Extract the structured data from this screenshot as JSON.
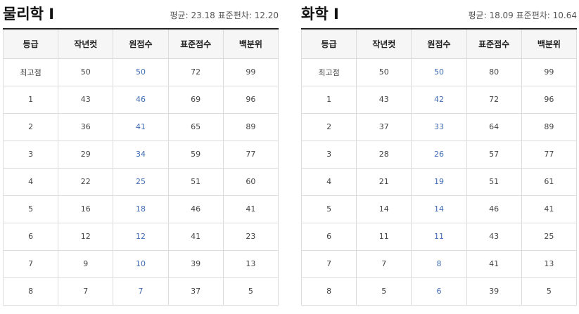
{
  "panels": [
    {
      "title": "물리학 Ⅰ",
      "stats_label": "평균: 23.18 표준편차: 12.20",
      "columns": [
        "등급",
        "작년컷",
        "원점수",
        "표준점수",
        "백분위"
      ],
      "rows": [
        [
          "최고점",
          "50",
          "50",
          "72",
          "99"
        ],
        [
          "1",
          "43",
          "46",
          "69",
          "96"
        ],
        [
          "2",
          "36",
          "41",
          "65",
          "89"
        ],
        [
          "3",
          "29",
          "34",
          "59",
          "77"
        ],
        [
          "4",
          "22",
          "25",
          "51",
          "60"
        ],
        [
          "5",
          "16",
          "18",
          "46",
          "41"
        ],
        [
          "6",
          "12",
          "12",
          "41",
          "23"
        ],
        [
          "7",
          "9",
          "10",
          "39",
          "13"
        ],
        [
          "8",
          "7",
          "7",
          "37",
          "5"
        ]
      ]
    },
    {
      "title": "화학 Ⅰ",
      "stats_label": "평균: 18.09 표준편차: 10.64",
      "columns": [
        "등급",
        "작년컷",
        "원점수",
        "표준점수",
        "백분위"
      ],
      "rows": [
        [
          "최고점",
          "50",
          "50",
          "80",
          "99"
        ],
        [
          "1",
          "43",
          "42",
          "72",
          "96"
        ],
        [
          "2",
          "37",
          "33",
          "64",
          "89"
        ],
        [
          "3",
          "28",
          "26",
          "57",
          "77"
        ],
        [
          "4",
          "21",
          "19",
          "51",
          "61"
        ],
        [
          "5",
          "14",
          "14",
          "46",
          "41"
        ],
        [
          "6",
          "11",
          "11",
          "43",
          "25"
        ],
        [
          "7",
          "7",
          "8",
          "41",
          "13"
        ],
        [
          "8",
          "5",
          "6",
          "39",
          "5"
        ]
      ]
    }
  ],
  "colors": {
    "raw_score": "#3f6bb3",
    "header_bg": "#f6f6f6",
    "border": "#dcdcdc",
    "title_rule": "#222222"
  }
}
